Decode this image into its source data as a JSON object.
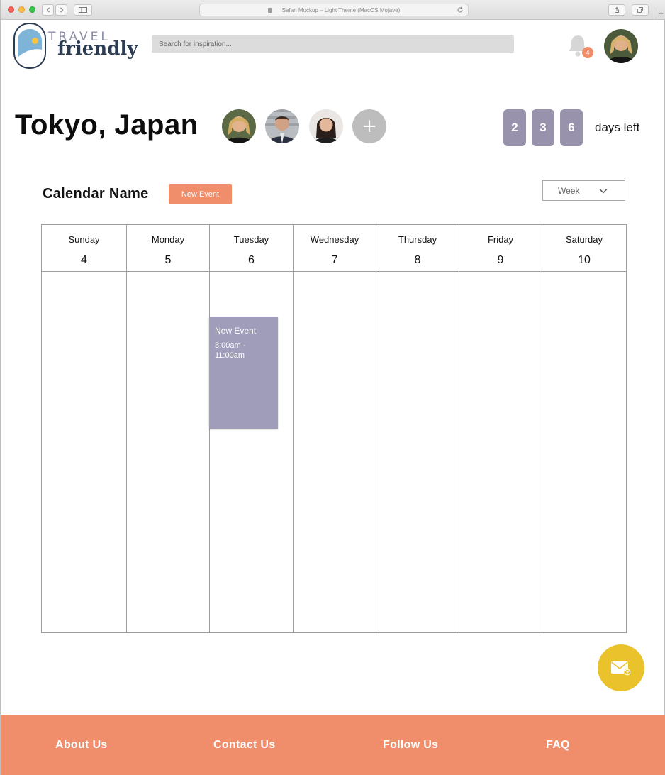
{
  "browser": {
    "address_text": "Safari Mockup – Light Theme (MacOS Mojave)"
  },
  "header": {
    "logo_line1": "TRAVEL",
    "logo_line2": "friendly",
    "search_placeholder": "Search for inspiration...",
    "notification_count": "4"
  },
  "trip": {
    "title": "Tokyo, Japan",
    "add_member_label": "+",
    "countdown_digits": [
      "2",
      "3",
      "6"
    ],
    "countdown_label": "days left"
  },
  "calendar": {
    "name": "Calendar Name",
    "new_event_label": "New Event",
    "view_selected": "Week",
    "days": [
      {
        "name": "Sunday",
        "date": "4"
      },
      {
        "name": "Monday",
        "date": "5"
      },
      {
        "name": "Tuesday",
        "date": "6"
      },
      {
        "name": "Wednesday",
        "date": "7"
      },
      {
        "name": "Thursday",
        "date": "8"
      },
      {
        "name": "Friday",
        "date": "9"
      },
      {
        "name": "Saturday",
        "date": "10"
      }
    ],
    "events": [
      {
        "title": "New Event",
        "time": "8:00am - 11:00am",
        "day": "Tuesday"
      }
    ]
  },
  "footer": {
    "links": [
      "About Us",
      "Contact Us",
      "Follow Us",
      "FAQ"
    ]
  },
  "colors": {
    "accent": "#f08e6c",
    "countdown": "#9892ad",
    "event": "#a09dbb",
    "fab": "#e9c22c",
    "logo_navy": "#2a3b52"
  },
  "icons": {
    "notification": "bell-icon",
    "message_fab": "envelope-icon",
    "view_dropdown": "chevron-down-icon"
  }
}
